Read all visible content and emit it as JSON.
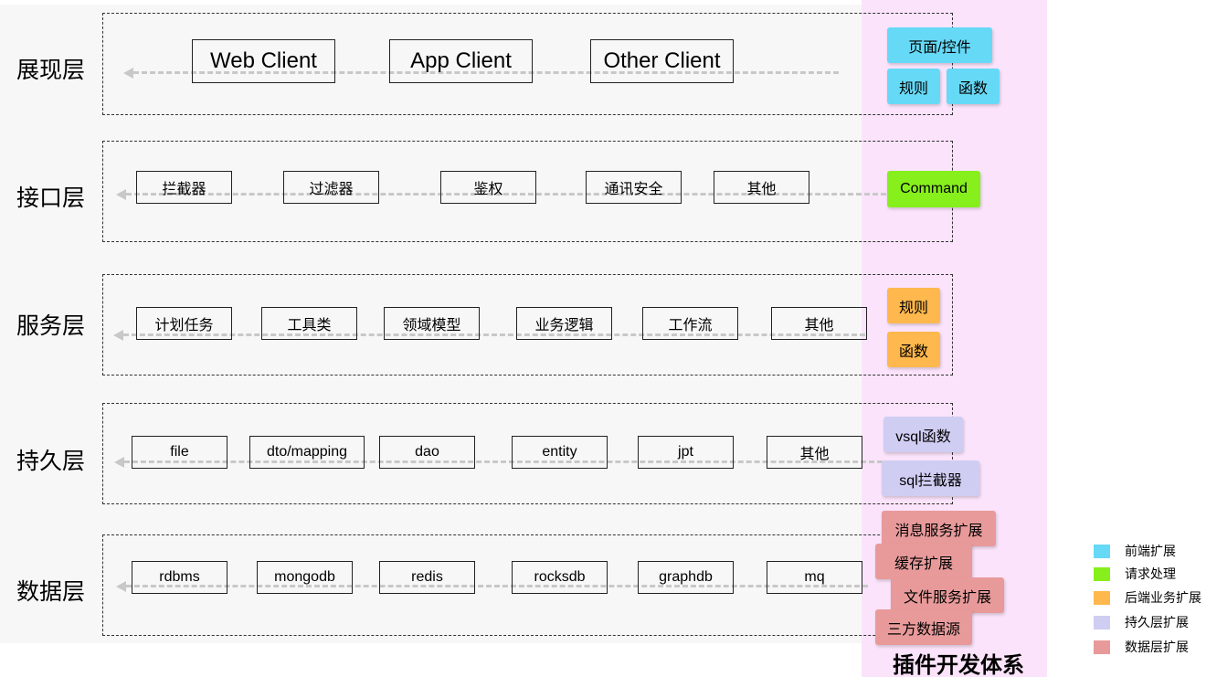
{
  "layers": [
    {
      "label": "展现层",
      "components": [
        "Web Client",
        "App Client",
        "Other Client"
      ]
    },
    {
      "label": "接口层",
      "components": [
        "拦截器",
        "过滤器",
        "鉴权",
        "通讯安全",
        "其他"
      ]
    },
    {
      "label": "服务层",
      "components": [
        "计划任务",
        "工具类",
        "领域模型",
        "业务逻辑",
        "工作流",
        "其他"
      ]
    },
    {
      "label": "持久层",
      "components": [
        "file",
        "dto/mapping",
        "dao",
        "entity",
        "jpt",
        "其他"
      ]
    },
    {
      "label": "数据层",
      "components": [
        "rdbms",
        "mongodb",
        "redis",
        "rocksdb",
        "graphdb",
        "mq"
      ]
    }
  ],
  "plugin": {
    "title": "插件开发体系",
    "frontend": [
      "页面/控件",
      "规则",
      "函数"
    ],
    "request": [
      "Command"
    ],
    "service": [
      "规则",
      "函数"
    ],
    "persistence": [
      "vsql函数",
      "sql拦截器"
    ],
    "data": [
      "消息服务扩展",
      "缓存扩展",
      "文件服务扩展",
      "三方数据源"
    ]
  },
  "legend": [
    {
      "label": "前端扩展",
      "color": "#66d9f7"
    },
    {
      "label": "请求处理",
      "color": "#86ef1c"
    },
    {
      "label": "后端业务扩展",
      "color": "#ffb84d"
    },
    {
      "label": "持久层扩展",
      "color": "#d0cdf3"
    },
    {
      "label": "数据层扩展",
      "color": "#e89a9a"
    }
  ],
  "colors": {
    "frontend": "#66d9f7",
    "request": "#86ef1c",
    "service": "#ffb84d",
    "persistence": "#d0cdf3",
    "data": "#e89a9a",
    "plugin_bg": "#fbe4fb",
    "panel_bg": "#f7f7f7",
    "flow_line": "#c8c8c8"
  }
}
